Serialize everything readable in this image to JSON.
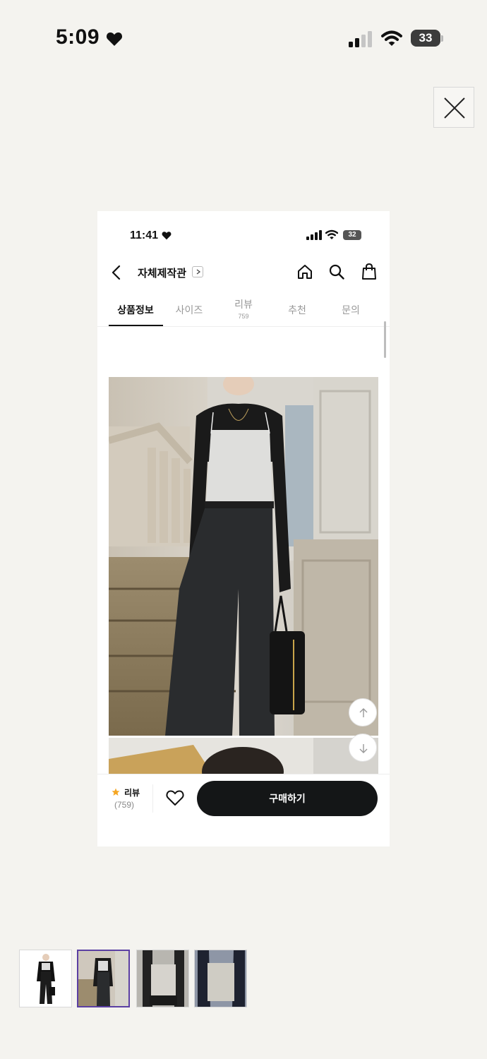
{
  "outer_status": {
    "time": "5:09",
    "battery_level": "33"
  },
  "viewer": {
    "close_icon": "close-icon"
  },
  "screenshot": {
    "status": {
      "time": "11:41",
      "battery_level": "32"
    },
    "header": {
      "store_title": "자체제작관"
    },
    "tabs": [
      {
        "label": "상품정보",
        "active": true
      },
      {
        "label": "사이즈"
      },
      {
        "label": "리뷰",
        "count": "759"
      },
      {
        "label": "추천"
      },
      {
        "label": "문의"
      }
    ],
    "bottom_bar": {
      "review_label": "리뷰",
      "review_count": "(759)",
      "buy_label": "구매하기",
      "star_color": "#f5a623"
    }
  },
  "thumbnails": {
    "count": 4,
    "selected_index": 1
  },
  "colors": {
    "background": "#f4f3ef",
    "buy_button": "#141617",
    "selected_thumb_border": "#5b3fa3"
  }
}
